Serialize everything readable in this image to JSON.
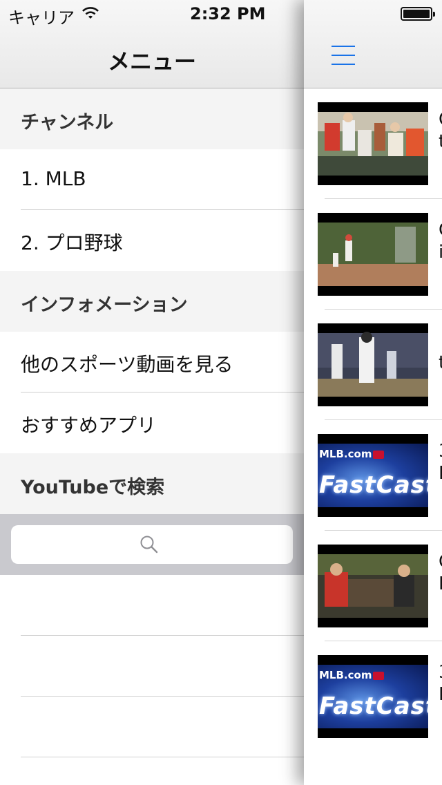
{
  "status_bar": {
    "carrier": "キャリア",
    "time": "2:32 PM"
  },
  "menu": {
    "title": "メニュー",
    "sections": [
      {
        "header": "チャンネル",
        "items": [
          "1. MLB",
          "2. プロ野球"
        ]
      },
      {
        "header": "インフォメーション",
        "items": [
          "他のスポーツ動画を見る",
          "おすすめアプリ"
        ]
      },
      {
        "header": "YouTubeで検索",
        "items": []
      }
    ],
    "search": {
      "placeholder": ""
    }
  },
  "content": {
    "icons": {
      "menu": "hamburger-menu-icon"
    },
    "videos": [
      {
        "thumb": "crowd-catch-thumbnail",
        "line1": "C",
        "line2": "t"
      },
      {
        "thumb": "ivy-wall-outfield-thumbnail",
        "line1": "C",
        "line2": "i"
      },
      {
        "thumb": "batter-swing-thumbnail",
        "line1": "",
        "line2": "t"
      },
      {
        "thumb": "mlb-fastcast-thumbnail",
        "line1": "3",
        "line2": "I",
        "logo": "MLB.com",
        "word": "FastCast"
      },
      {
        "thumb": "interview-couch-thumbnail",
        "line1": "C",
        "line2": "I"
      },
      {
        "thumb": "mlb-fastcast-thumbnail",
        "line1": "3",
        "line2": "I",
        "logo": "MLB.com",
        "word": "FastCast"
      }
    ]
  },
  "colors": {
    "accent": "#1a73e8",
    "section_bg": "#f4f4f4",
    "search_bar_bg": "#c9c9ce"
  }
}
